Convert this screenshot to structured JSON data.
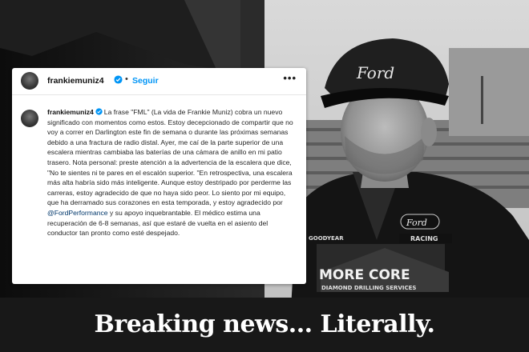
{
  "post": {
    "username": "frankiemuniz4",
    "follow_label": "Seguir",
    "more_label": "•••",
    "caption_before_mention": "La frase \"FML\" (La vida de Frankie Muniz) cobra un nuevo significado con momentos como estos. Estoy decepcionado de compartir que no voy a correr en Darlington este fin de semana o durante las próximas semanas debido a una fractura de radio distal. Ayer, me caí de la parte superior de una escalera mientras cambiaba las baterías de una cámara de anillo en mi patio trasero. Nota personal: preste atención a la advertencia de la escalera que dice, \"No te sientes ni te pares en el escalón superior. \"En retrospectiva, una escalera más alta habría sido más inteligente. Aunque estoy destripado por perderme las carreras, estoy agradecido de que no haya sido peor. Lo siento por mi equipo, que ha derramado sus corazones en esta temporada, y estoy agradecido por ",
    "mention": "@FordPerformance",
    "caption_after_mention": " y su apoyo inquebrantable. El médico estima una recuperación de 6-8 semanas, así que estaré de vuelta en el asiento del conductor tan pronto como esté despejado."
  },
  "photo": {
    "cap_logo": "Ford",
    "chest_logo": "Ford",
    "racing_logo": "RACING",
    "goodyear_logo": "GOODYEAR",
    "sponsor_line1": "MORE CORE",
    "sponsor_line2": "DIAMOND DRILLING SERVICES"
  },
  "headline": "Breaking news... Literally.",
  "colors": {
    "follow_blue": "#0095f6",
    "verified_blue": "#0095f6",
    "mention_blue": "#00376b",
    "headline_white": "#ffffff"
  },
  "icons": [
    "verified-icon",
    "more-options-icon"
  ]
}
